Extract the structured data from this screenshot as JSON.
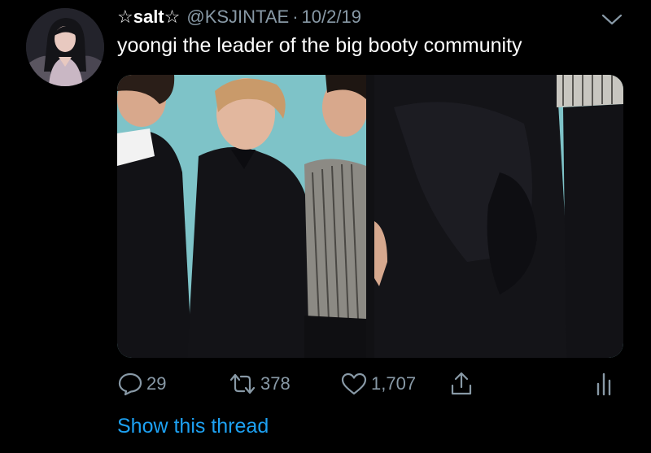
{
  "tweet": {
    "display_name": "☆salt☆",
    "handle": "@KSJINTAE",
    "separator": "·",
    "date": "10/2/19",
    "text": "yoongi the leader of the big booty community"
  },
  "actions": {
    "replies": "29",
    "retweets": "378",
    "likes": "1,707"
  },
  "thread_link": "Show this thread",
  "icons": {
    "more": "chevron-down-icon",
    "reply": "reply-icon",
    "retweet": "retweet-icon",
    "like": "heart-icon",
    "share": "share-icon",
    "analytics": "analytics-icon"
  },
  "colors": {
    "background": "#000000",
    "text": "#ffffff",
    "secondary": "#8899a6",
    "link": "#1da1f2"
  }
}
